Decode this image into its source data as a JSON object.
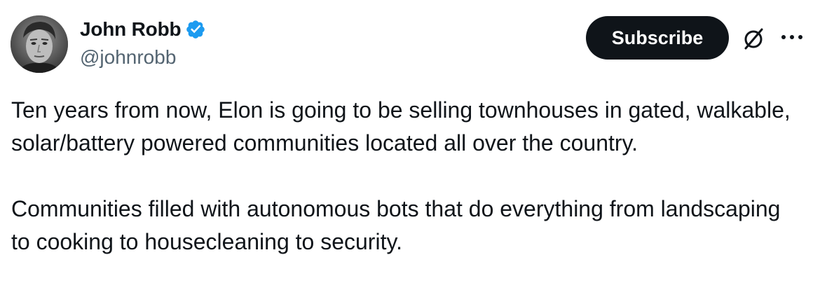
{
  "author": {
    "display_name": "John Robb",
    "handle": "@johnrobb",
    "verified": true,
    "avatar_icon": "avatar-photo"
  },
  "actions": {
    "subscribe_label": "Subscribe",
    "grok_icon": "grok-slash-circle-icon",
    "more_icon": "more-horizontal-icon"
  },
  "tweet": {
    "paragraphs": [
      "Ten years from now, Elon is going to be selling townhouses in gated, walkable, solar/battery powered communities located all over the country.",
      "Communities filled with autonomous bots that do everything from landscaping to cooking to housecleaning to security."
    ]
  },
  "colors": {
    "text_primary": "#0f1419",
    "text_secondary": "#536471",
    "verified_blue": "#1d9bf0",
    "button_bg": "#0f1419",
    "button_text": "#ffffff"
  }
}
